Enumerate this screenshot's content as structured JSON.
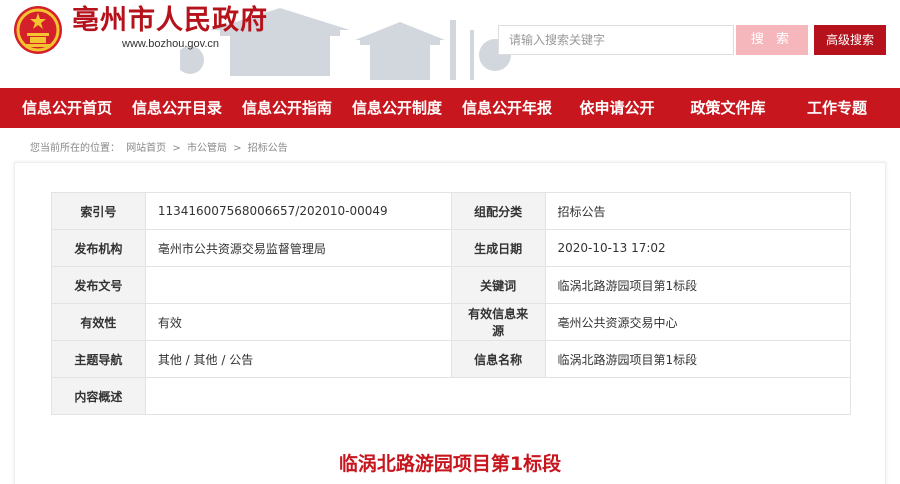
{
  "header": {
    "site_title": "亳州市人民政府",
    "site_url": "www.bozhou.gov.cn",
    "search_placeholder": "请输入搜索关键字",
    "search_button": "搜 索",
    "advanced_search_button": "高级搜索"
  },
  "nav": {
    "items": [
      {
        "label": "信息公开首页"
      },
      {
        "label": "信息公开目录"
      },
      {
        "label": "信息公开指南"
      },
      {
        "label": "信息公开制度"
      },
      {
        "label": "信息公开年报"
      },
      {
        "label": "依申请公开"
      },
      {
        "label": "政策文件库"
      },
      {
        "label": "工作专题"
      }
    ]
  },
  "breadcrumb": {
    "prefix": "您当前所在的位置：",
    "items": [
      "网站首页",
      "市公管局",
      "招标公告"
    ],
    "separator": ">"
  },
  "meta": {
    "index_label": "索引号",
    "index_value": "113416007568006657/202010-00049",
    "category_label": "组配分类",
    "category_value": "招标公告",
    "publisher_label": "发布机构",
    "publisher_value": "亳州市公共资源交易监督管理局",
    "date_label": "生成日期",
    "date_value": "2020-10-13 17:02",
    "docno_label": "发布文号",
    "docno_value": "",
    "keyword_label": "关键词",
    "keyword_value": "临涡北路游园项目第1标段",
    "validity_label": "有效性",
    "validity_value": "有效",
    "source_label": "有效信息来源",
    "source_value": "亳州公共资源交易中心",
    "topic_label": "主题导航",
    "topic_value": "其他 / 其他 / 公告",
    "name_label": "信息名称",
    "name_value": "临涡北路游园项目第1标段",
    "summary_label": "内容概述",
    "summary_value": ""
  },
  "document": {
    "title": "临涡北路游园项目第1标段"
  },
  "colors": {
    "brand_red": "#c8161e",
    "search_pink": "#f6b7bc"
  }
}
